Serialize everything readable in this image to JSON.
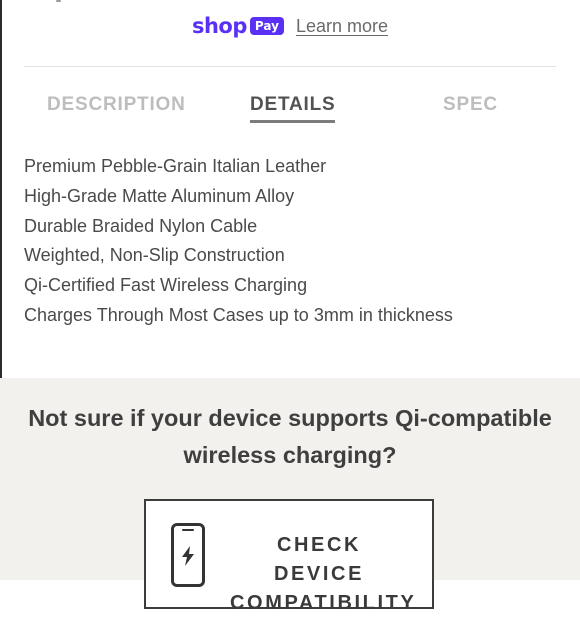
{
  "shop_pay": {
    "shop_text": "shop",
    "pay_text": "Pay",
    "learn_more": "Learn more",
    "brand_color": "#5a31f4"
  },
  "tabs": [
    {
      "label": "DESCRIPTION",
      "active": false
    },
    {
      "label": "DETAILS",
      "active": true
    },
    {
      "label": "SPEC",
      "active": false
    }
  ],
  "features": [
    "Premium Pebble-Grain Italian Leather",
    "High-Grade Matte Aluminum Alloy",
    "Durable Braided Nylon Cable",
    "Weighted, Non-Slip Construction",
    "Qi-Certified Fast Wireless Charging",
    "Charges Through Most Cases up to 3mm in thickness"
  ],
  "qi_section": {
    "question_line1": "Not sure if your device supports Qi-compatible",
    "question_line2": "wireless charging?",
    "button_line1": "CHECK DEVICE",
    "button_line2": "COMPATIBILITY",
    "button_icon": "phone-charging-icon",
    "background_color": "#f3f1ee"
  }
}
